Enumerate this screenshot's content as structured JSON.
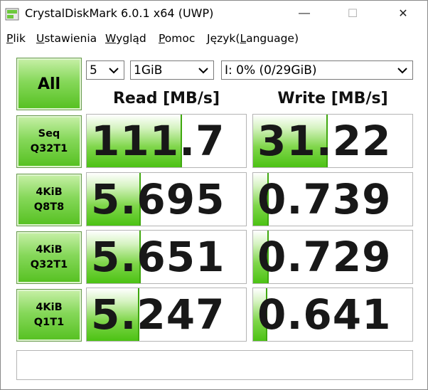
{
  "window": {
    "title": "CrystalDiskMark 6.0.1 x64 (UWP)",
    "controls": {
      "minimize": "—",
      "maximize": "☐",
      "close": "✕"
    }
  },
  "menu": {
    "items": [
      {
        "accel": "P",
        "rest": "lik"
      },
      {
        "accel": "U",
        "rest": "stawienia"
      },
      {
        "accel": "W",
        "rest": "ygląd"
      },
      {
        "accel": "P",
        "rest": "omoc"
      },
      {
        "pre": "Język(",
        "accel": "L",
        "rest": "anguage)"
      }
    ]
  },
  "controls": {
    "all_label": "All",
    "count": "5",
    "size": "1GiB",
    "drive": "I: 0% (0/29GiB)"
  },
  "headers": {
    "read": "Read [MB/s]",
    "write": "Write [MB/s]"
  },
  "tests": [
    {
      "line1": "Seq",
      "line2": "Q32T1",
      "read": "111.7",
      "write": "31.22",
      "read_fill": 0.6,
      "write_fill": 0.47
    },
    {
      "line1": "4KiB",
      "line2": "Q8T8",
      "read": "5.695",
      "write": "0.739",
      "read_fill": 0.34,
      "write_fill": 0.1
    },
    {
      "line1": "4KiB",
      "line2": "Q32T1",
      "read": "5.651",
      "write": "0.729",
      "read_fill": 0.34,
      "write_fill": 0.1
    },
    {
      "line1": "4KiB",
      "line2": "Q1T1",
      "read": "5.247",
      "write": "0.641",
      "read_fill": 0.33,
      "write_fill": 0.09
    }
  ],
  "colors": {
    "accent_green": "#55c020",
    "bar_edge": "#3fa80e"
  },
  "icons": {
    "app": "crystaldiskmark-app-icon",
    "dropdown": "chevron-down-icon"
  }
}
